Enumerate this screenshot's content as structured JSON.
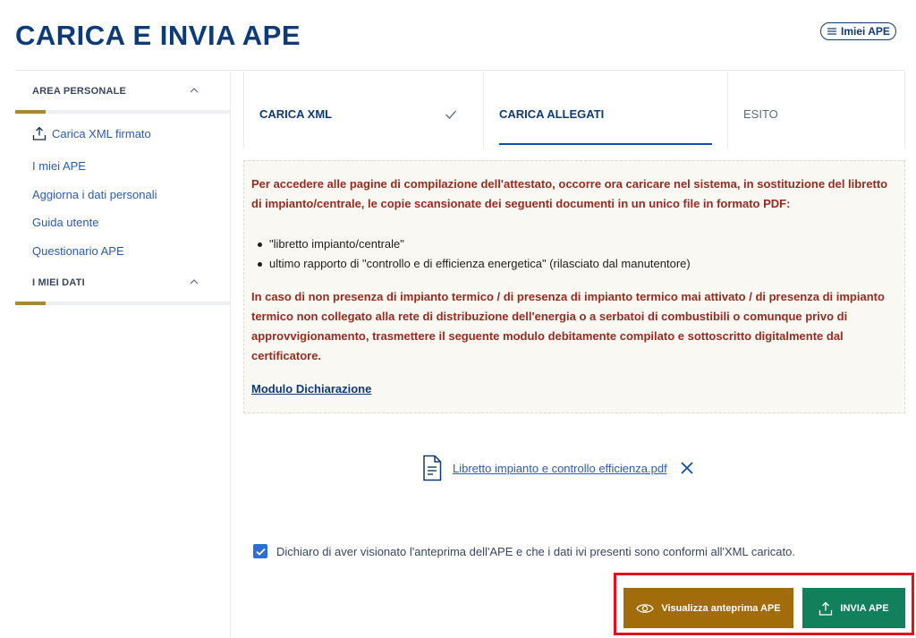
{
  "header": {
    "title": "CARICA E INVIA APE",
    "my_ape_button": "Imiei APE"
  },
  "sidebar": {
    "section1": "AREA PERSONALE",
    "items": [
      {
        "label": "Carica XML firmato",
        "icon": "upload-icon"
      },
      {
        "label": "I miei APE"
      },
      {
        "label": "Aggiorna i dati personali"
      },
      {
        "label": "Guida utente"
      },
      {
        "label": "Questionario APE"
      }
    ],
    "section2": "I MIEI DATI"
  },
  "steps": [
    {
      "label": "CARICA XML",
      "state": "done"
    },
    {
      "label": "CARICA ALLEGATI",
      "state": "active"
    },
    {
      "label": "ESITO",
      "state": "pending"
    }
  ],
  "info": {
    "intro": "Per accedere alle pagine di compilazione dell'attestato, occorre ora caricare nel sistema, in sostituzione del libretto di impianto/centrale, le copie scansionate dei seguenti documenti in un unico file in formato PDF:",
    "bullets": [
      "\"libretto impianto/centrale\"",
      "ultimo rapporto di \"controllo e di efficienza energetica\" (rilasciato dal manutentore)"
    ],
    "note": "In caso di non presenza di impianto termico / di presenza di impianto termico mai attivato / di presenza di impianto termico non collegato alla rete di distribuzione dell'energia o a serbatoi di combustibili o comunque privo di approvvigionamento, trasmettere il seguente modulo debitamente compilato e sottoscritto digitalmente dal certificatore.",
    "link": "Modulo Dichiarazione"
  },
  "file": {
    "name": "Libretto impianto e controllo efficienza.pdf",
    "icon": "document-icon"
  },
  "declaration": {
    "checked": true,
    "text": "Dichiaro di aver visionato l'anteprima dell'APE e che i dati ivi presenti sono conformi all'XML caricato."
  },
  "actions": {
    "preview": "Visualizza anteprima APE",
    "send": "INVIA APE"
  },
  "colors": {
    "brand": "#0d3b7a",
    "alert": "#9b2a1e",
    "preview_button": "#a36c0b",
    "send_button": "#12805a",
    "highlight": "#e0121b",
    "accent": "#a88a2a"
  }
}
